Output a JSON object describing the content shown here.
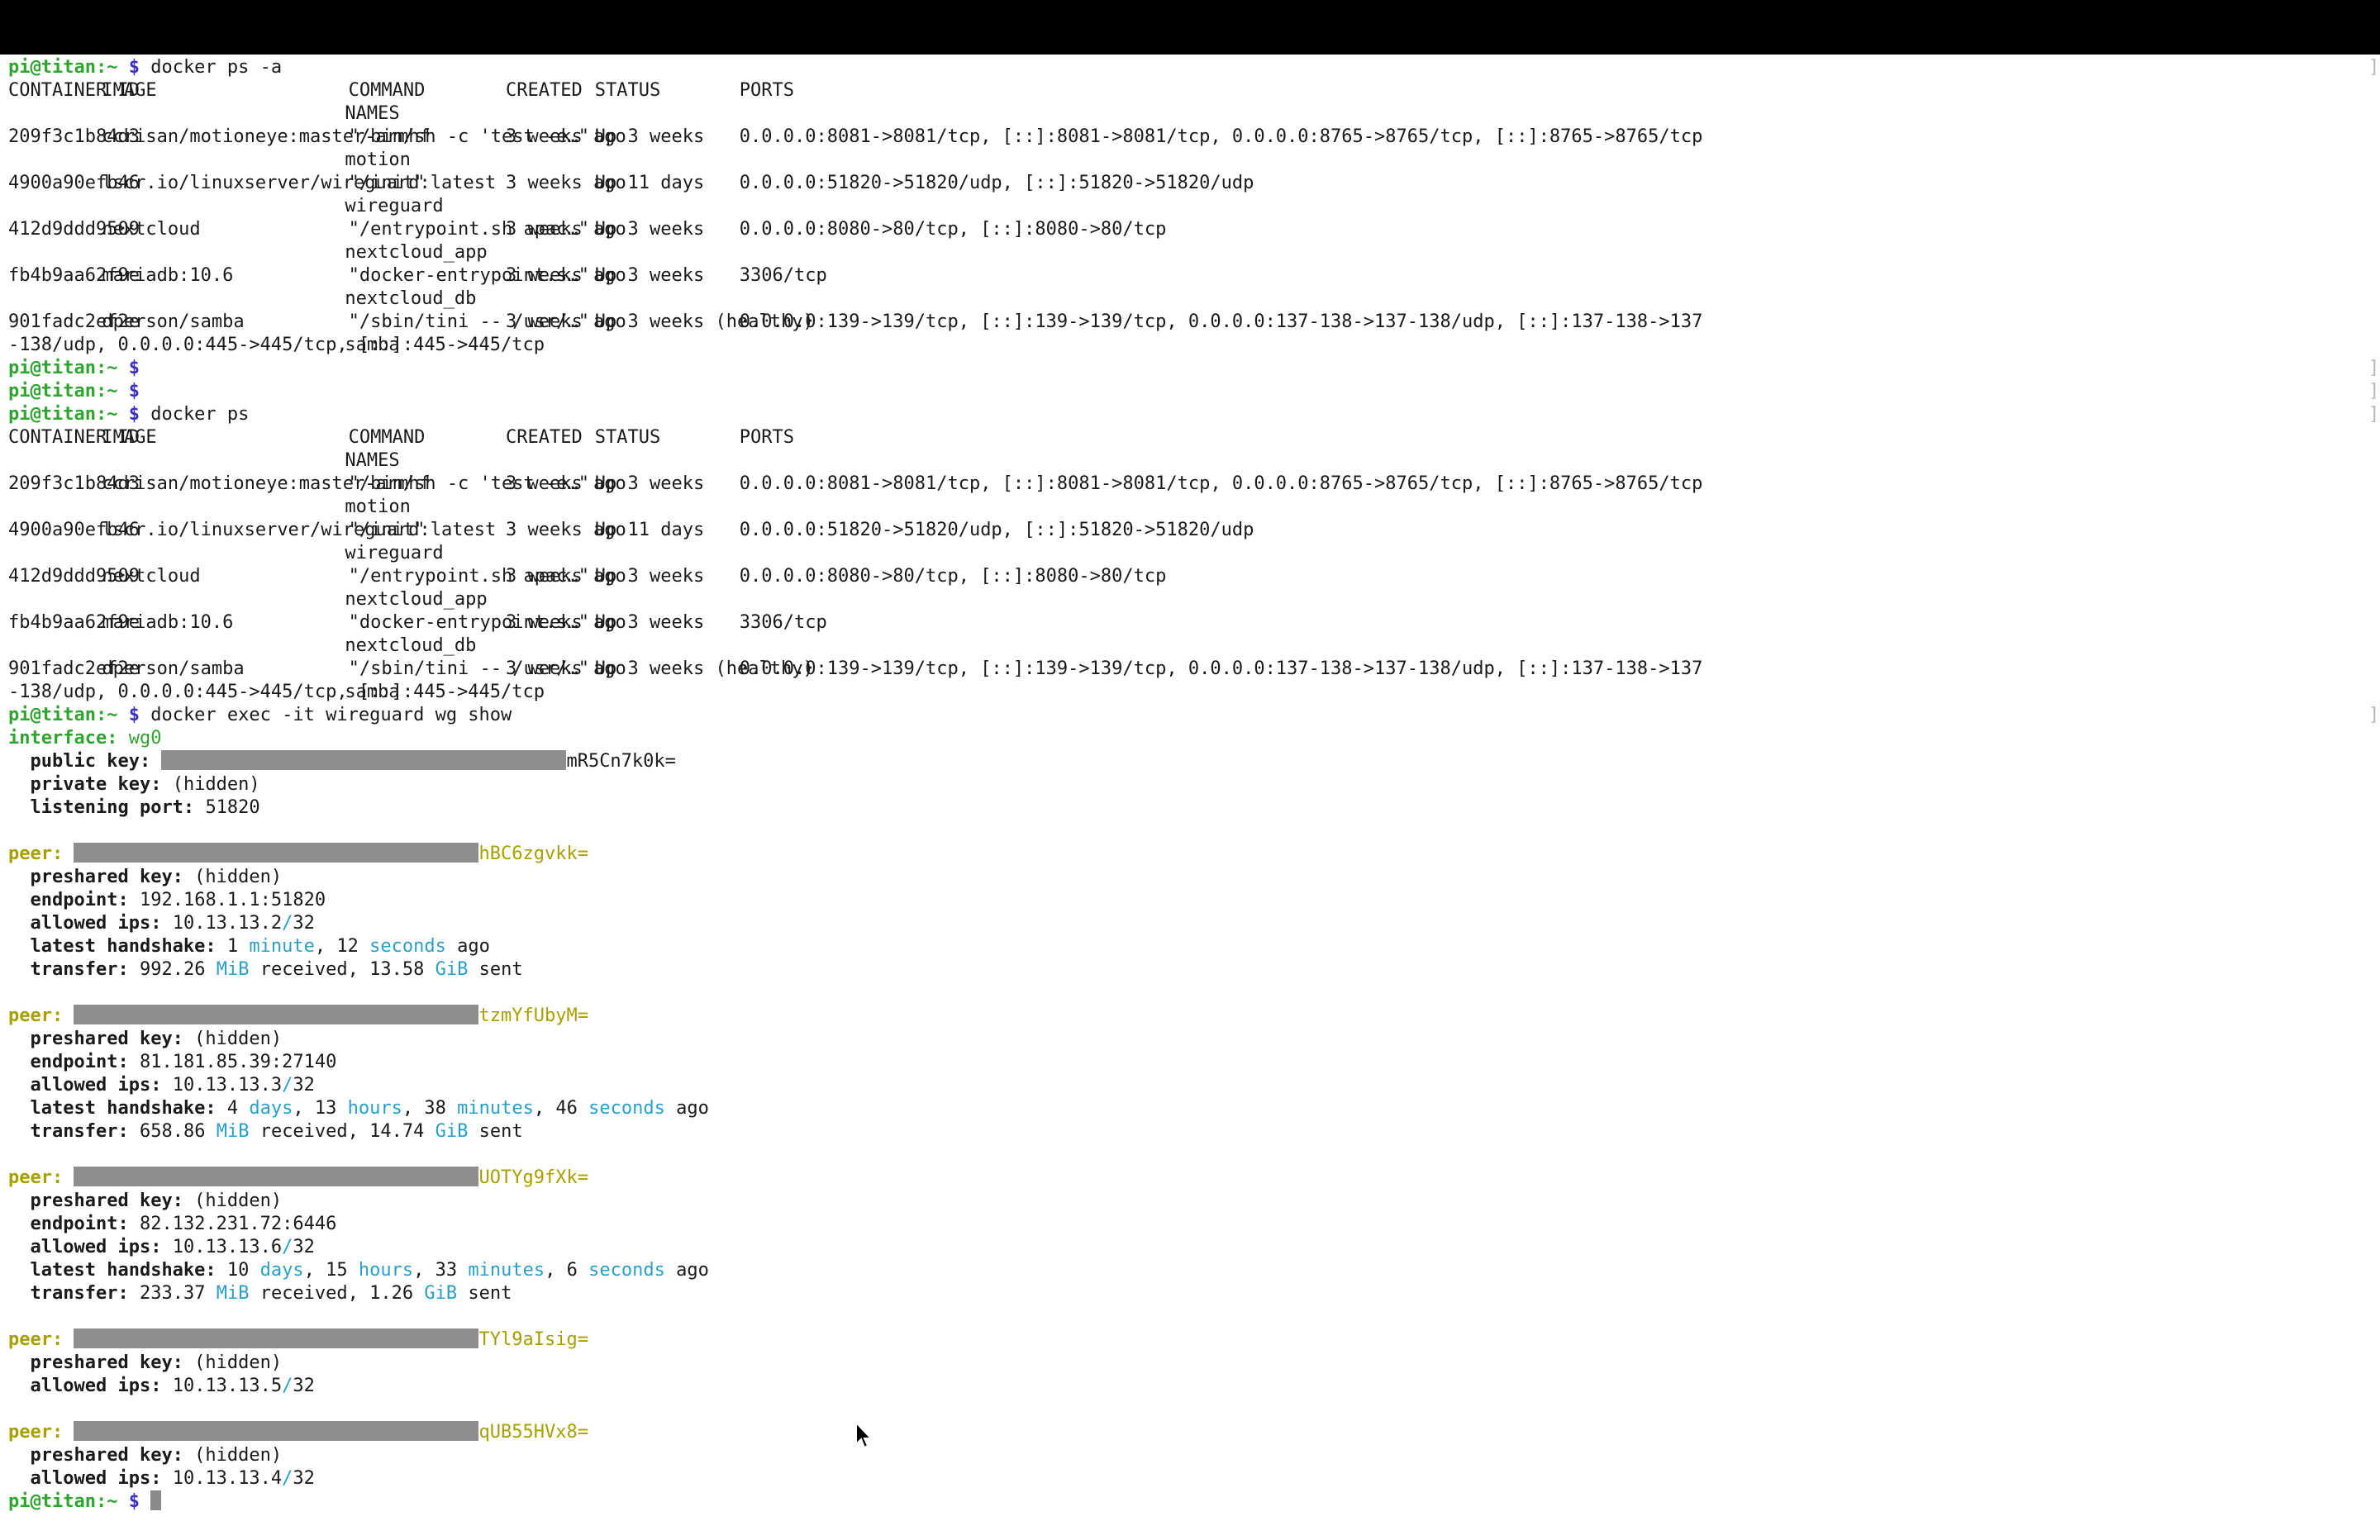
{
  "prompt": {
    "user_host": "pi@titan",
    "path": ":~",
    "dollar": "$"
  },
  "commands": {
    "ps_all": "docker ps -a",
    "ps": "docker ps",
    "exec": "docker exec -it wireguard wg show"
  },
  "docker_table": {
    "headers": {
      "container_id": "CONTAINER ID",
      "image": "IMAGE",
      "command": "COMMAND",
      "created": "CREATED",
      "status": "STATUS",
      "ports": "PORTS",
      "names": "NAMES"
    },
    "rows": [
      {
        "id": "209f3c1b84d3",
        "image": "ccrisan/motioneye:master-armhf",
        "command": "\"/bin/sh -c 'test -e…\"",
        "created": "3 weeks ago",
        "status": "Up 3 weeks",
        "ports": "0.0.0.0:8081->8081/tcp, [::]:8081->8081/tcp, 0.0.0.0:8765->8765/tcp, [::]:8765->8765/tcp",
        "ports_wrap": "",
        "name": "motion"
      },
      {
        "id": "4900a90efb46",
        "image": "lscr.io/linuxserver/wireguard:latest",
        "command": "\"/init\"",
        "created": "3 weeks ago",
        "status": "Up 11 days",
        "ports": "0.0.0.0:51820->51820/udp, [::]:51820->51820/udp",
        "ports_wrap": "",
        "name": "wireguard"
      },
      {
        "id": "412d9ddd9509",
        "image": "nextcloud",
        "command": "\"/entrypoint.sh apac…\"",
        "created": "3 weeks ago",
        "status": "Up 3 weeks",
        "ports": "0.0.0.0:8080->80/tcp, [::]:8080->80/tcp",
        "ports_wrap": "",
        "name": "nextcloud_app"
      },
      {
        "id": "fb4b9aa62f9e",
        "image": "mariadb:10.6",
        "command": "\"docker-entrypoint.s…\"",
        "created": "3 weeks ago",
        "status": "Up 3 weeks",
        "ports": "3306/tcp",
        "ports_wrap": "",
        "name": "nextcloud_db"
      },
      {
        "id": "901fadc2ef2e",
        "image": "dperson/samba",
        "command": "\"/sbin/tini -- /usr/…\"",
        "created": "3 weeks ago",
        "status": "Up 3 weeks (healthy)",
        "ports": "0.0.0.0:139->139/tcp, [::]:139->139/tcp, 0.0.0.0:137-138->137-138/udp, [::]:137-138->137",
        "ports_wrap": "-138/udp, 0.0.0.0:445->445/tcp, [::]:445->445/tcp",
        "name": "samba"
      }
    ]
  },
  "wg": {
    "interface_label": "interface:",
    "interface_name": "wg0",
    "public_key_label": "public key:",
    "public_key_suffix": "mR5Cn7k0k=",
    "private_key_label": "private key:",
    "private_key_value": "(hidden)",
    "listening_port_label": "listening port:",
    "listening_port": "51820",
    "labels": {
      "peer": "peer:",
      "preshared": "preshared key:",
      "endpoint": "endpoint:",
      "allowed_ips": "allowed ips:",
      "handshake": "latest handshake:",
      "transfer": "transfer:",
      "hidden": "(hidden)",
      "ago": "ago",
      "received": "received,",
      "sent": "sent"
    },
    "peers": [
      {
        "key_suffix": "hBC6zgvkk=",
        "endpoint": "192.168.1.1:51820",
        "allowed_ip": "10.13.13.2",
        "allowed_mask": "32",
        "handshake": [
          {
            "n": "1",
            "u": "minute"
          },
          {
            "n": "12",
            "u": "seconds"
          }
        ],
        "received": "992.26",
        "received_unit": "MiB",
        "sent": "13.58",
        "sent_unit": "GiB"
      },
      {
        "key_suffix": "tzmYfUbyM=",
        "endpoint": "81.181.85.39:27140",
        "allowed_ip": "10.13.13.3",
        "allowed_mask": "32",
        "handshake": [
          {
            "n": "4",
            "u": "days"
          },
          {
            "n": "13",
            "u": "hours"
          },
          {
            "n": "38",
            "u": "minutes"
          },
          {
            "n": "46",
            "u": "seconds"
          }
        ],
        "received": "658.86",
        "received_unit": "MiB",
        "sent": "14.74",
        "sent_unit": "GiB"
      },
      {
        "key_suffix": "UOTYg9fXk=",
        "endpoint": "82.132.231.72:6446",
        "allowed_ip": "10.13.13.6",
        "allowed_mask": "32",
        "handshake": [
          {
            "n": "10",
            "u": "days"
          },
          {
            "n": "15",
            "u": "hours"
          },
          {
            "n": "33",
            "u": "minutes"
          },
          {
            "n": "6",
            "u": "seconds"
          }
        ],
        "received": "233.37",
        "received_unit": "MiB",
        "sent": "1.26",
        "sent_unit": "GiB"
      },
      {
        "key_suffix": "TYl9aIsig=",
        "allowed_ip": "10.13.13.5",
        "allowed_mask": "32"
      },
      {
        "key_suffix": "qUB55HVx8=",
        "allowed_ip": "10.13.13.4",
        "allowed_mask": "32"
      }
    ]
  },
  "colors": {
    "background": "#ffffff",
    "title_bar": "#000000",
    "prompt_user": "#2fa52f",
    "prompt_dollar": "#3b2fbf",
    "peer": "#a7a000",
    "unit": "#2aa0c8",
    "redaction": "#8e8e8e"
  },
  "icons": {
    "pointer": "mouse-pointer-icon",
    "cursor": "text-cursor-block"
  }
}
